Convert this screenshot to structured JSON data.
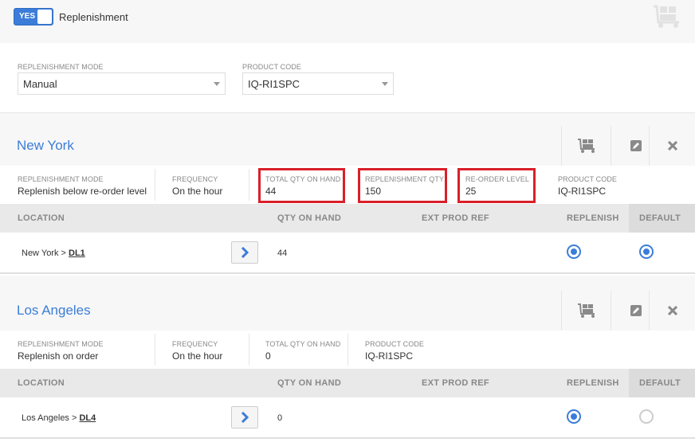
{
  "toggle": {
    "state_label": "YES",
    "label": "Replenishment",
    "on": true
  },
  "top_icon": "cart-icon",
  "selectors": {
    "mode_label": "REPLENISHMENT MODE",
    "mode_value": "Manual",
    "product_label": "PRODUCT CODE",
    "product_value": "IQ-RI1SPC"
  },
  "colors": {
    "accent": "#3b7dd8",
    "highlight": "#d9202a"
  },
  "locations": [
    {
      "title": "New York",
      "summary": {
        "mode_label": "REPLENISHMENT MODE",
        "mode_value": "Replenish below re-order level",
        "freq_label": "FREQUENCY",
        "freq_value": "On the hour",
        "total_label": "TOTAL QTY ON HAND",
        "total_value": "44",
        "repl_qty_label": "REPLENISHMENT QTY",
        "repl_qty_value": "150",
        "reorder_label": "RE-ORDER LEVEL",
        "reorder_value": "25",
        "product_label": "PRODUCT CODE",
        "product_value": "IQ-RI1SPC"
      },
      "columns": {
        "location": "LOCATION",
        "qty": "QTY ON HAND",
        "ext": "EXT PROD REF",
        "replenish": "REPLENISH",
        "default": "DEFAULT"
      },
      "row": {
        "loc_prefix": "New York > ",
        "loc_link": "DL1",
        "qty": "44",
        "replenish": true,
        "default": true
      }
    },
    {
      "title": "Los Angeles",
      "summary": {
        "mode_label": "REPLENISHMENT MODE",
        "mode_value": "Replenish on order",
        "freq_label": "FREQUENCY",
        "freq_value": "On the hour",
        "total_label": "TOTAL QTY ON HAND",
        "total_value": "0",
        "product_label": "PRODUCT CODE",
        "product_value": "IQ-RI1SPC"
      },
      "columns": {
        "location": "LOCATION",
        "qty": "QTY ON HAND",
        "ext": "EXT PROD REF",
        "replenish": "REPLENISH",
        "default": "DEFAULT"
      },
      "row": {
        "loc_prefix": "Los Angeles > ",
        "loc_link": "DL4",
        "qty": "0",
        "replenish": true,
        "default": false
      }
    }
  ]
}
